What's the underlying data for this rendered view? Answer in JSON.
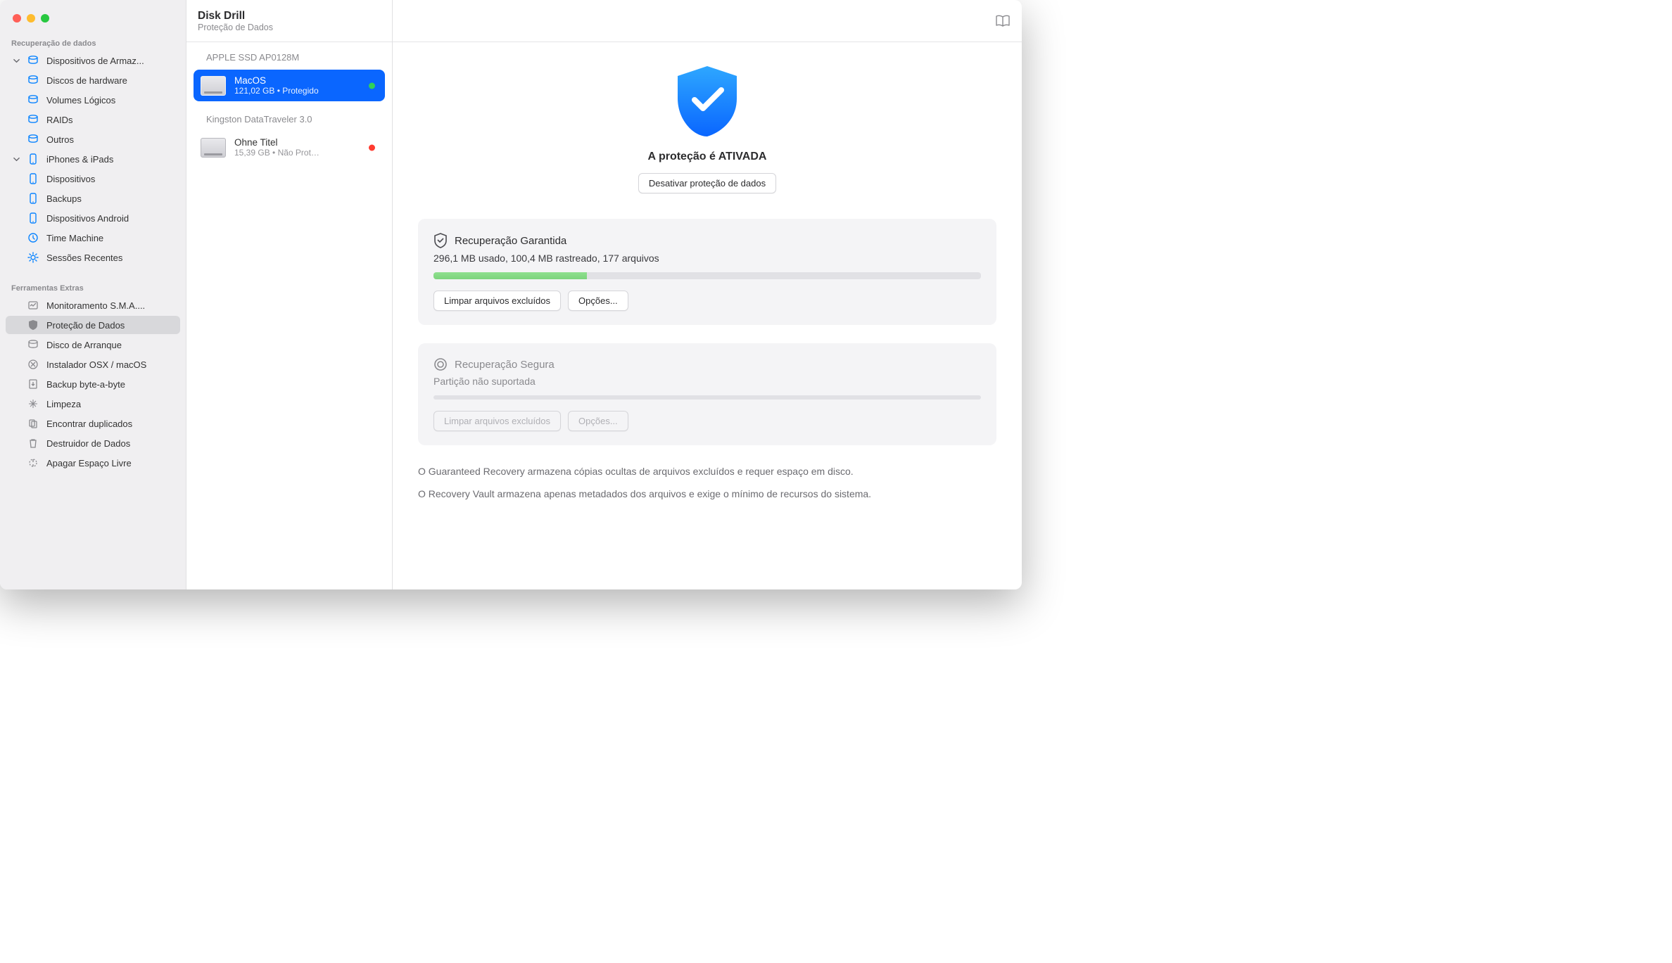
{
  "header": {
    "title": "Disk Drill",
    "subtitle": "Proteção de Dados"
  },
  "sidebar": {
    "section1_label": "Recuperação de dados",
    "storage_devices_label": "Dispositivos de Armaz...",
    "hardware_disks_label": "Discos de hardware",
    "logical_volumes_label": "Volumes Lógicos",
    "raids_label": "RAIDs",
    "others_label": "Outros",
    "iphones_ipads_label": "iPhones & iPads",
    "ios_devices_label": "Dispositivos",
    "ios_backups_label": "Backups",
    "android_label": "Dispositivos Android",
    "time_machine_label": "Time Machine",
    "recent_sessions_label": "Sessões Recentes",
    "section2_label": "Ferramentas Extras",
    "smart_label": "Monitoramento S.M.A....",
    "data_protection_label": "Proteção de Dados",
    "boot_disk_label": "Disco de Arranque",
    "installer_label": "Instalador OSX / macOS",
    "byte_backup_label": "Backup byte-a-byte",
    "cleanup_label": "Limpeza",
    "find_dup_label": "Encontrar duplicados",
    "data_destroyer_label": "Destruidor de Dados",
    "erase_free_label": "Apagar Espaço Livre"
  },
  "partitions": {
    "group1_label": "APPLE SSD AP0128M",
    "p1_name": "MacOS",
    "p1_sub": "121,02 GB • Protegido",
    "group2_label": "Kingston DataTraveler 3.0",
    "p2_name": "Ohne Titel",
    "p2_sub": "15,39 GB • Não Prot…"
  },
  "main": {
    "hero_title": "A proteção é ATIVADA",
    "deactivate_button": "Desativar proteção de dados",
    "card1_title": "Recuperação Garantida",
    "card1_sub": "296,1 MB usado, 100,4 MB rastreado, 177 arquivos",
    "card1_btn1": "Limpar arquivos excluídos",
    "card1_btn2": "Opções...",
    "card1_progress_pct": 28,
    "card2_title": "Recuperação Segura",
    "card2_sub": "Partição não suportada",
    "card2_btn1": "Limpar arquivos excluídos",
    "card2_btn2": "Opções...",
    "footnote1": "O Guaranteed Recovery armazena cópias ocultas de arquivos excluídos e requer espaço em disco.",
    "footnote2": "O Recovery Vault armazena apenas metadados dos arquivos e exige o mínimo de recursos do sistema."
  }
}
